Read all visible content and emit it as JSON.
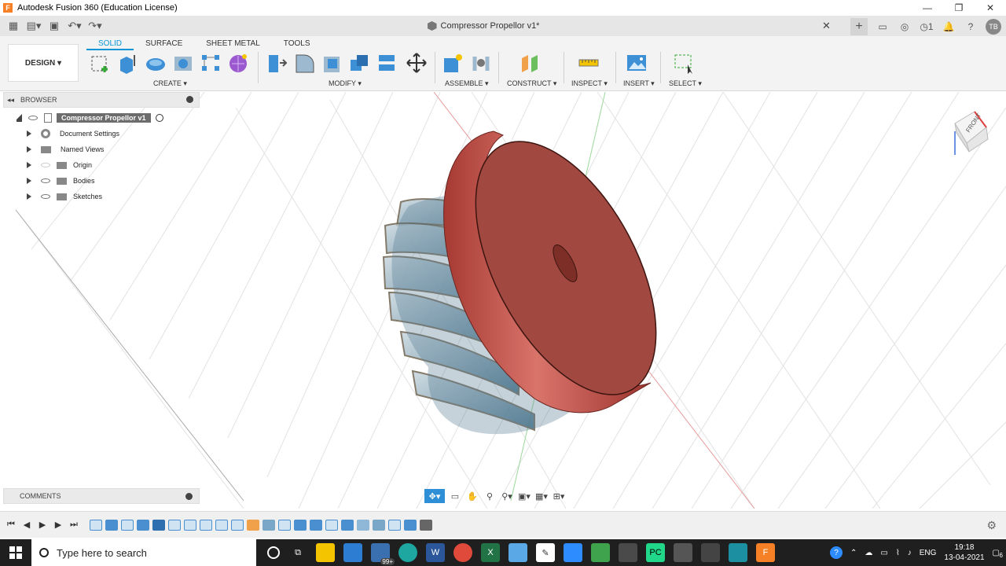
{
  "window": {
    "title": "Autodesk Fusion 360 (Education License)",
    "app_icon": "F"
  },
  "doc_tab": {
    "title": "Compressor Propellor v1*"
  },
  "top_right": {
    "job_count": "1",
    "avatar": "TB"
  },
  "toolbar": {
    "tabs": [
      "SOLID",
      "SURFACE",
      "SHEET METAL",
      "TOOLS"
    ],
    "active_tab": "SOLID",
    "workspace": "DESIGN ▾",
    "groups": [
      "CREATE ▾",
      "MODIFY ▾",
      "ASSEMBLE ▾",
      "CONSTRUCT ▾",
      "INSPECT ▾",
      "INSERT ▾",
      "SELECT ▾"
    ]
  },
  "browser": {
    "title": "BROWSER",
    "root": "Compressor Propellor v1",
    "items": [
      "Document Settings",
      "Named Views",
      "Origin",
      "Bodies",
      "Sketches"
    ]
  },
  "comments": {
    "title": "COMMENTS"
  },
  "viewcube": {
    "face": "FRONT"
  },
  "taskbar": {
    "search_placeholder": "Type here to search",
    "badge": "99+",
    "language": "ENG",
    "time": "19:18",
    "date": "13-04-2021",
    "notifications": "6"
  },
  "colors": {
    "accent": "#0696d7",
    "model_red": "#b8403a",
    "blade_blue": "#5a7f94"
  }
}
